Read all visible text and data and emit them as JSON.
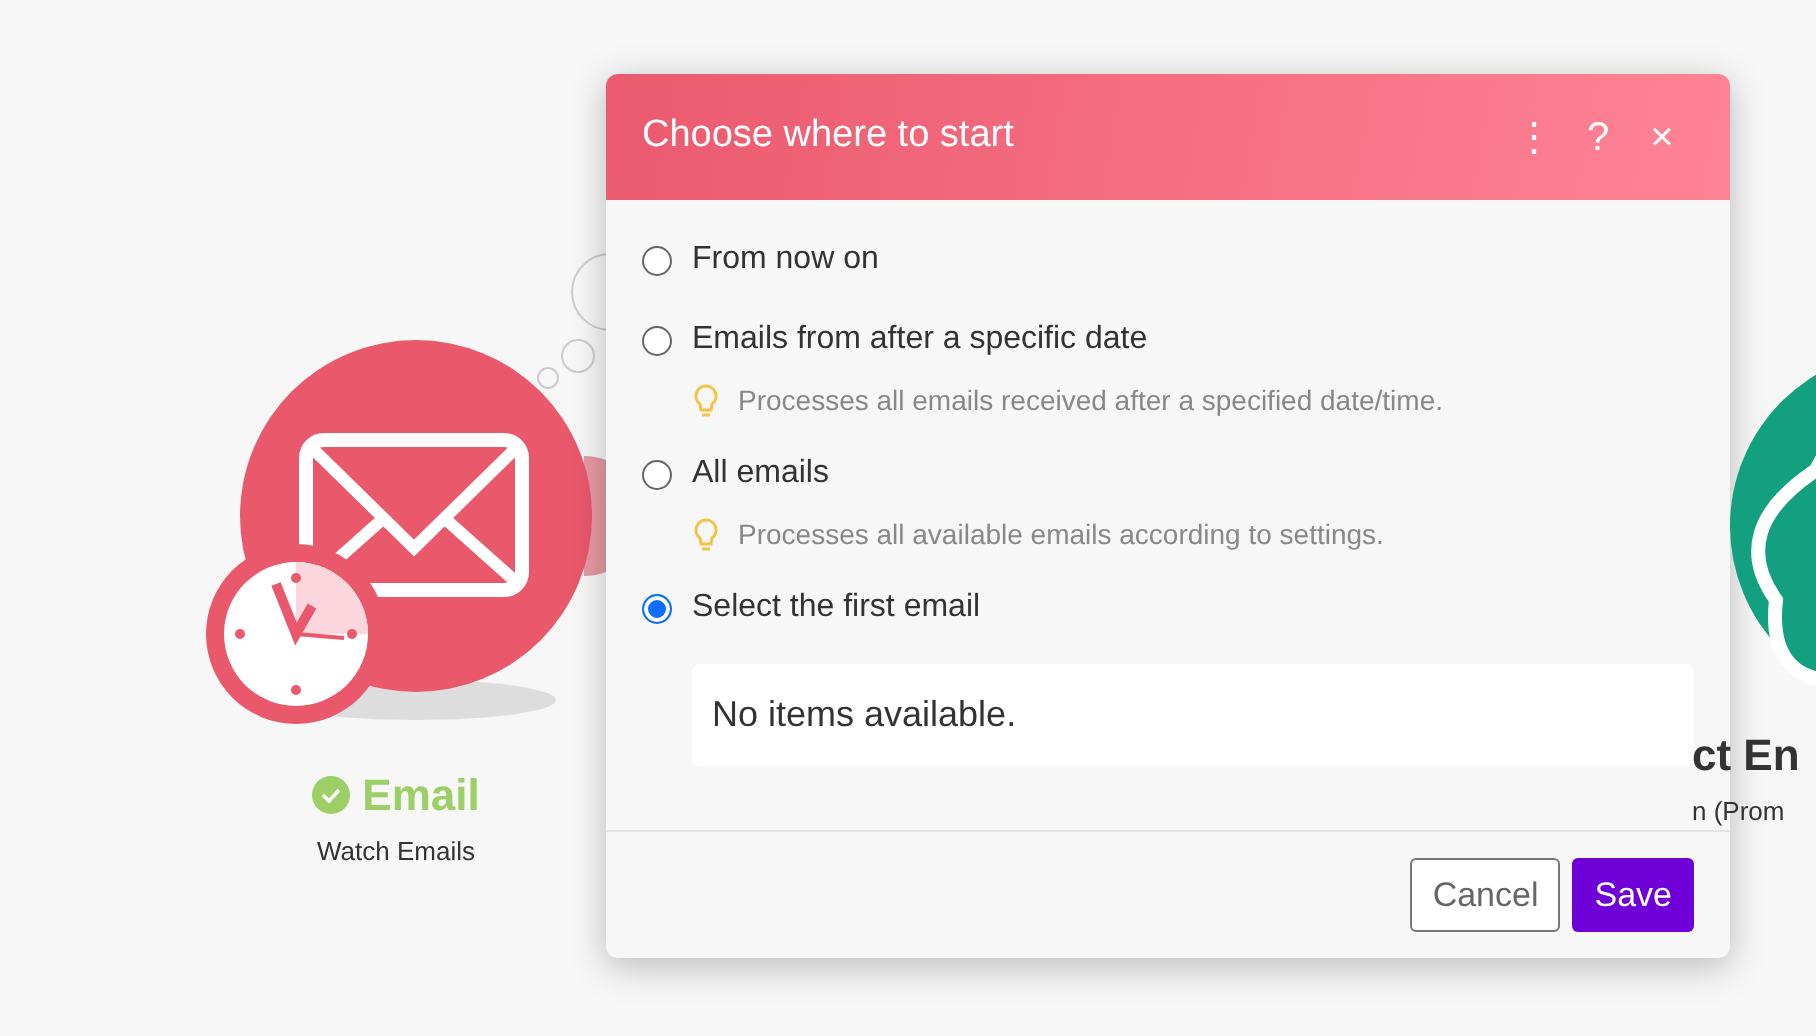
{
  "canvas": {
    "nodes": [
      {
        "kind": "email",
        "title": "Email",
        "subtitle": "Watch Emails",
        "complete": true
      },
      {
        "kind": "ai",
        "title": "ct En",
        "subtitle": "n (Prom"
      }
    ]
  },
  "dialog": {
    "title": "Choose where to start",
    "header_icons": [
      "⋮",
      "?",
      "×"
    ],
    "options": [
      {
        "label": "From now on",
        "selected": false
      },
      {
        "label": "Emails from after a specific date",
        "selected": false,
        "hint": "Processes all emails received after a specified date/time."
      },
      {
        "label": "All emails",
        "selected": false,
        "hint": "Processes all available emails according to settings."
      },
      {
        "label": "Select the first email",
        "selected": true
      }
    ],
    "list_box": {
      "text": "No items available."
    },
    "buttons": [
      {
        "label": "Cancel",
        "kind": "secondary"
      },
      {
        "label": "Save",
        "kind": "primary"
      }
    ]
  }
}
